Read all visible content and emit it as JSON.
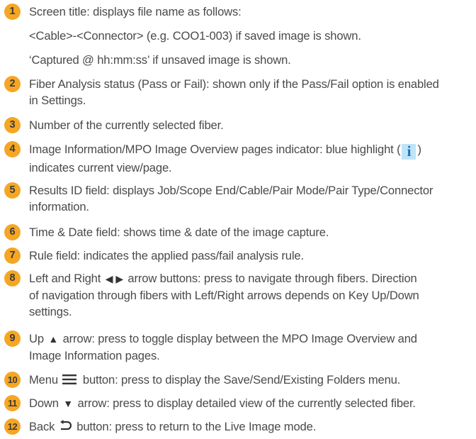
{
  "colors": {
    "badge": "#f5a623",
    "text": "#4a4a4a",
    "info_highlight": "#bfe4f7",
    "info_glyph": "#1a74b8"
  },
  "items": [
    {
      "num": "1",
      "text": "Screen title: displays file name as follows:",
      "sub1": "<Cable>-<Connector> (e.g. COO1-003) if saved image is shown.",
      "sub2": "‘Captured @ hh:mm:ss’ if unsaved image is shown."
    },
    {
      "num": "2",
      "line1": "Fiber Analysis status (Pass or Fail): shown only if the Pass/Fail option is enabled",
      "line2": "in Settings."
    },
    {
      "num": "3",
      "text": "Number of the currently selected fiber."
    },
    {
      "num": "4",
      "line1a": "Image Information/MPO Image Overview pages indicator: blue highlight (",
      "info_icon": "i",
      "line1b": ")",
      "line2": "indicates current view/page."
    },
    {
      "num": "5",
      "line1": "Results ID field: displays Job/Scope End/Cable/Pair Mode/Pair Type/Connector",
      "line2": "information."
    },
    {
      "num": "6",
      "text": "Time & Date field: shows time & date of the image capture."
    },
    {
      "num": "7",
      "text": "Rule field: indicates the applied pass/fail analysis rule."
    },
    {
      "num": "8",
      "line1a": "Left and Right",
      "left_icon": "◀",
      "right_icon": "▶",
      "line1b": "arrow buttons: press to navigate through fibers. Direction",
      "line2": "of navigation through fibers with Left/Right arrows depends on Key Up/Down",
      "line3": "settings."
    },
    {
      "num": "9",
      "line1a": "Up",
      "up_icon": "▲",
      "line1b": "arrow: press to toggle display between the MPO Image Overview and",
      "line2": "Image Information pages."
    },
    {
      "num": "10",
      "line1a": "Menu",
      "menu_icon": "menu-icon",
      "line1b": "button: press to display the Save/Send/Existing Folders menu."
    },
    {
      "num": "11",
      "line1a": "Down",
      "down_icon": "▼",
      "line1b": "arrow: press to display detailed view of the currently selected fiber."
    },
    {
      "num": "12",
      "line1a": "Back",
      "back_icon": "back-icon",
      "line1b": "button: press to return to the Live Image mode."
    }
  ]
}
